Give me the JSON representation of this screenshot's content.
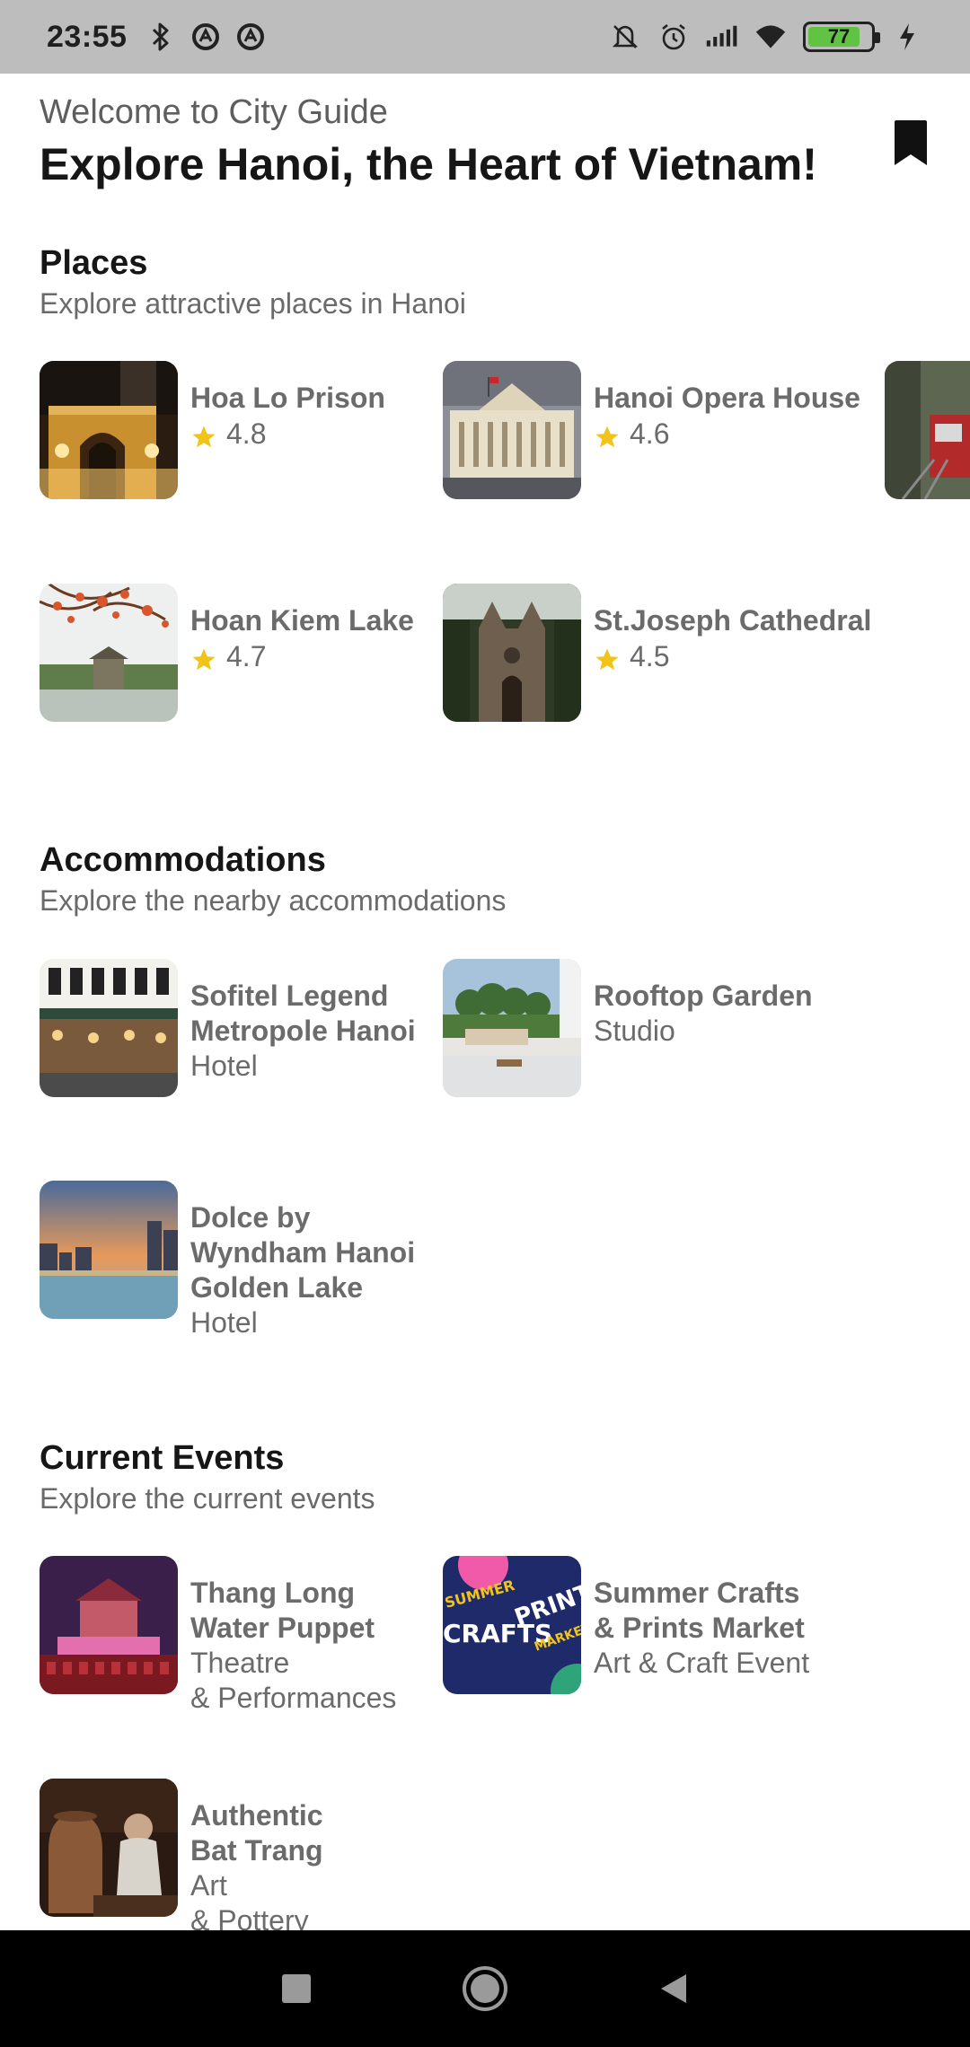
{
  "status_bar": {
    "time": "23:55",
    "battery_level": "77",
    "icons": [
      "bluetooth-icon",
      "vpn-icon",
      "vpn-icon",
      "mute-icon",
      "alarm-icon",
      "signal-icon",
      "wifi-icon",
      "battery-icon",
      "charging-icon"
    ]
  },
  "header": {
    "welcome": "Welcome to City Guide",
    "title": "Explore Hanoi, the Heart of Vietnam!",
    "bookmark_icon": "bookmark-icon"
  },
  "places": {
    "title": "Places",
    "subtitle": "Explore attractive places in Hanoi",
    "items": [
      {
        "name": "Hoa Lo Prison",
        "rating": "4.8"
      },
      {
        "name": "Hanoi Opera House",
        "rating": "4.6"
      },
      {
        "name": "Hoan Kiem Lake",
        "rating": "4.7"
      },
      {
        "name": "St.Joseph Cathedral",
        "rating": "4.5"
      }
    ]
  },
  "accommodations": {
    "title": "Accommodations",
    "subtitle": "Explore the nearby accommodations",
    "items": [
      {
        "name_lines": [
          "Sofitel Legend",
          "Metropole Hanoi"
        ],
        "type": "Hotel"
      },
      {
        "name_lines": [
          "Rooftop Garden"
        ],
        "type": "Studio"
      },
      {
        "name_lines": [
          "Dolce by",
          "Wyndham Hanoi",
          "Golden Lake"
        ],
        "type": "Hotel"
      }
    ]
  },
  "events": {
    "title": "Current Events",
    "subtitle": "Explore the current events",
    "items": [
      {
        "name_lines": [
          "Thang Long",
          "Water Puppet"
        ],
        "type_lines": [
          "Theatre",
          "& Performances"
        ]
      },
      {
        "name_lines": [
          "Summer Crafts",
          "& Prints Market"
        ],
        "type_lines": [
          "Art & Craft Event"
        ]
      },
      {
        "name_lines": [
          "Authentic",
          "Bat Trang"
        ],
        "type_lines": [
          "Art",
          "& Pottery"
        ]
      }
    ],
    "poster_text": [
      "SUMMER",
      "CRAFTS",
      "PRINTS",
      "MARKET"
    ]
  },
  "colors": {
    "star": "#f2c318",
    "status_bar_bg": "#bdbdbd",
    "battery_fill": "#61c244"
  }
}
